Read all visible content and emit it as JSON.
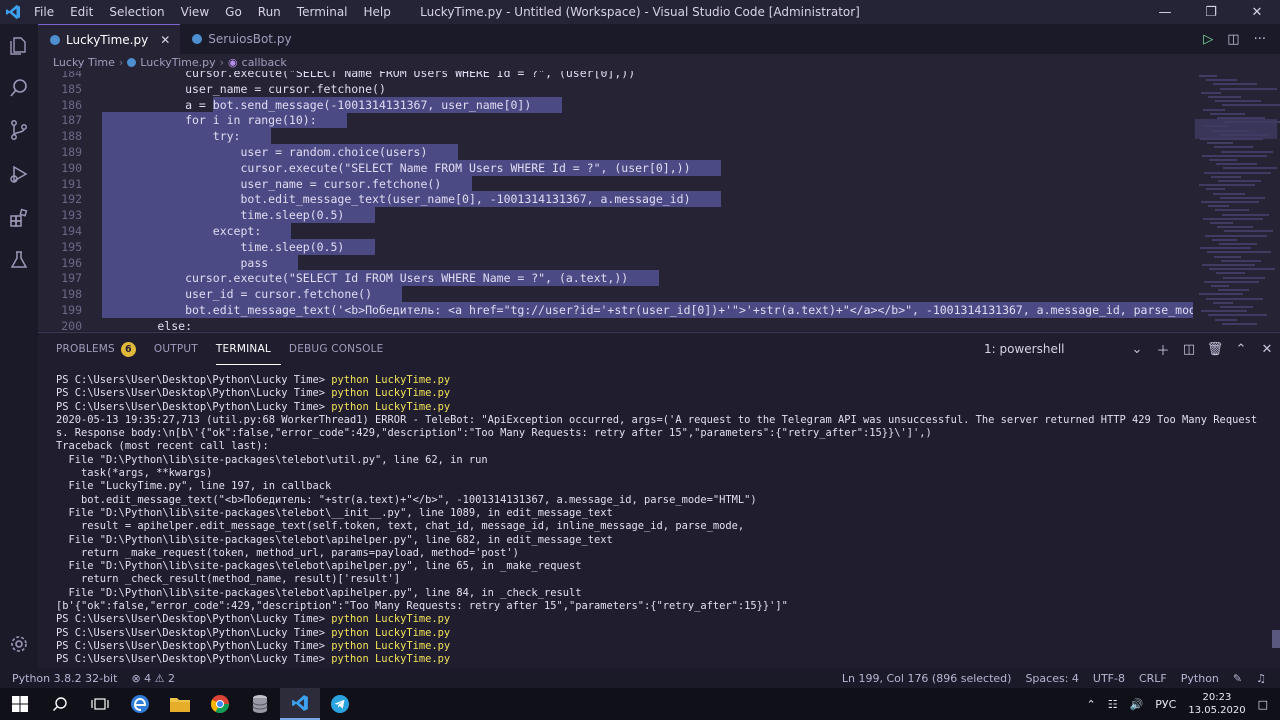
{
  "window": {
    "title": "LuckyTime.py - Untitled (Workspace) - Visual Studio Code [Administrator]",
    "menu": [
      "File",
      "Edit",
      "Selection",
      "View",
      "Go",
      "Run",
      "Terminal",
      "Help"
    ]
  },
  "tabs": [
    {
      "label": "LuckyTime.py",
      "active": true
    },
    {
      "label": "SeruiosBot.py",
      "active": false
    }
  ],
  "breadcrumb": [
    "Lucky Time",
    "LuckyTime.py",
    "callback"
  ],
  "editor": {
    "lines": [
      {
        "n": "184",
        "code": "            cursor.execute(\"SELECT Name FROM Users WHERE Id = ?\", (user[0],))",
        "sel": false
      },
      {
        "n": "185",
        "code": "            user_name = cursor.fetchone()",
        "sel": false
      },
      {
        "n": "186",
        "code": "            a = bot.send_message(-1001314131367, user_name[0])",
        "sel": true
      },
      {
        "n": "187",
        "code": "            for i in range(10):",
        "sel": true
      },
      {
        "n": "188",
        "code": "                try:",
        "sel": true
      },
      {
        "n": "189",
        "code": "                    user = random.choice(users)",
        "sel": true
      },
      {
        "n": "190",
        "code": "                    cursor.execute(\"SELECT Name FROM Users WHERE Id = ?\", (user[0],))",
        "sel": true
      },
      {
        "n": "191",
        "code": "                    user_name = cursor.fetchone()",
        "sel": true
      },
      {
        "n": "192",
        "code": "                    bot.edit_message_text(user_name[0], -1001314131367, a.message_id)",
        "sel": true
      },
      {
        "n": "193",
        "code": "                    time.sleep(0.5)",
        "sel": true
      },
      {
        "n": "194",
        "code": "                except:",
        "sel": true
      },
      {
        "n": "195",
        "code": "                    time.sleep(0.5)",
        "sel": true
      },
      {
        "n": "196",
        "code": "                    pass",
        "sel": true
      },
      {
        "n": "197",
        "code": "            cursor.execute(\"SELECT Id FROM Users WHERE Name = ?\", (a.text,))",
        "sel": true
      },
      {
        "n": "198",
        "code": "            user_id = cursor.fetchone()",
        "sel": true
      },
      {
        "n": "199",
        "code": "            bot.edit_message_text('<b>Победитель: <a href=\"tg://user?id='+str(user_id[0])+'\">'+str(a.text)+\"</a></b>\", -1001314131367, a.message_id, parse_mode=\"HTML\")",
        "sel": true
      },
      {
        "n": "200",
        "code": "        else:",
        "sel": false
      }
    ]
  },
  "panel": {
    "tabs": [
      {
        "label": "PROBLEMS",
        "badge": "6"
      },
      {
        "label": "OUTPUT",
        "badge": ""
      },
      {
        "label": "TERMINAL",
        "badge": ""
      },
      {
        "label": "DEBUG CONSOLE",
        "badge": ""
      }
    ],
    "active_tab": "TERMINAL",
    "terminal_select": "1: powershell",
    "terminal_lines": [
      {
        "prompt": "PS C:\\Users\\User\\Desktop\\Python\\Lucky Time> ",
        "cmd": "python LuckyTime.py",
        "text": ""
      },
      {
        "prompt": "PS C:\\Users\\User\\Desktop\\Python\\Lucky Time> ",
        "cmd": "python LuckyTime.py",
        "text": ""
      },
      {
        "prompt": "PS C:\\Users\\User\\Desktop\\Python\\Lucky Time> ",
        "cmd": "python LuckyTime.py",
        "text": ""
      },
      {
        "prompt": "",
        "cmd": "",
        "text": "2020-05-13 19:35:27,713 (util.py:68 WorkerThread1) ERROR - TeleBot: \"ApiException occurred, args=('A request to the Telegram API was unsuccessful. The server returned HTTP 429 Too Many Requests. Response body:\\n[b\\'{\"ok\":false,\"error_code\":429,\"description\":\"Too Many Requests: retry after 15\",\"parameters\":{\"retry_after\":15}}\\']',)"
      },
      {
        "prompt": "",
        "cmd": "",
        "text": "Traceback (most recent call last):"
      },
      {
        "prompt": "",
        "cmd": "",
        "text": "  File \"D:\\Python\\lib\\site-packages\\telebot\\util.py\", line 62, in run"
      },
      {
        "prompt": "",
        "cmd": "",
        "text": "    task(*args, **kwargs)"
      },
      {
        "prompt": "",
        "cmd": "",
        "text": "  File \"LuckyTime.py\", line 197, in callback"
      },
      {
        "prompt": "",
        "cmd": "",
        "text": "    bot.edit_message_text(\"<b>Победитель: \"+str(a.text)+\"</b>\", -1001314131367, a.message_id, parse_mode=\"HTML\")"
      },
      {
        "prompt": "",
        "cmd": "",
        "text": "  File \"D:\\Python\\lib\\site-packages\\telebot\\__init__.py\", line 1089, in edit_message_text"
      },
      {
        "prompt": "",
        "cmd": "",
        "text": "    result = apihelper.edit_message_text(self.token, text, chat_id, message_id, inline_message_id, parse_mode,"
      },
      {
        "prompt": "",
        "cmd": "",
        "text": "  File \"D:\\Python\\lib\\site-packages\\telebot\\apihelper.py\", line 682, in edit_message_text"
      },
      {
        "prompt": "",
        "cmd": "",
        "text": "    return _make_request(token, method_url, params=payload, method='post')"
      },
      {
        "prompt": "",
        "cmd": "",
        "text": "  File \"D:\\Python\\lib\\site-packages\\telebot\\apihelper.py\", line 65, in _make_request"
      },
      {
        "prompt": "",
        "cmd": "",
        "text": "    return _check_result(method_name, result)['result']"
      },
      {
        "prompt": "",
        "cmd": "",
        "text": "  File \"D:\\Python\\lib\\site-packages\\telebot\\apihelper.py\", line 84, in _check_result"
      },
      {
        "prompt": "",
        "cmd": "",
        "text": "[b'{\"ok\":false,\"error_code\":429,\"description\":\"Too Many Requests: retry after 15\",\"parameters\":{\"retry_after\":15}}']\""
      },
      {
        "prompt": "PS C:\\Users\\User\\Desktop\\Python\\Lucky Time> ",
        "cmd": "python LuckyTime.py",
        "text": ""
      },
      {
        "prompt": "PS C:\\Users\\User\\Desktop\\Python\\Lucky Time> ",
        "cmd": "python LuckyTime.py",
        "text": ""
      },
      {
        "prompt": "PS C:\\Users\\User\\Desktop\\Python\\Lucky Time> ",
        "cmd": "python LuckyTime.py",
        "text": ""
      },
      {
        "prompt": "PS C:\\Users\\User\\Desktop\\Python\\Lucky Time> ",
        "cmd": "python LuckyTime.py",
        "text": ""
      }
    ]
  },
  "status": {
    "python": "Python 3.8.2 32-bit",
    "problems": "⊗ 4 ⚠ 2",
    "position": "Ln 199, Col 176 (896 selected)",
    "spaces": "Spaces: 4",
    "encoding": "UTF-8",
    "eol": "CRLF",
    "language": "Python"
  },
  "taskbar": {
    "lang": "РУС",
    "time": "20:23",
    "date": "13.05.2020"
  },
  "colors": {
    "accent": "#7f64d6",
    "selection": "#4b4a85",
    "terminal_command": "#f2e35a"
  }
}
